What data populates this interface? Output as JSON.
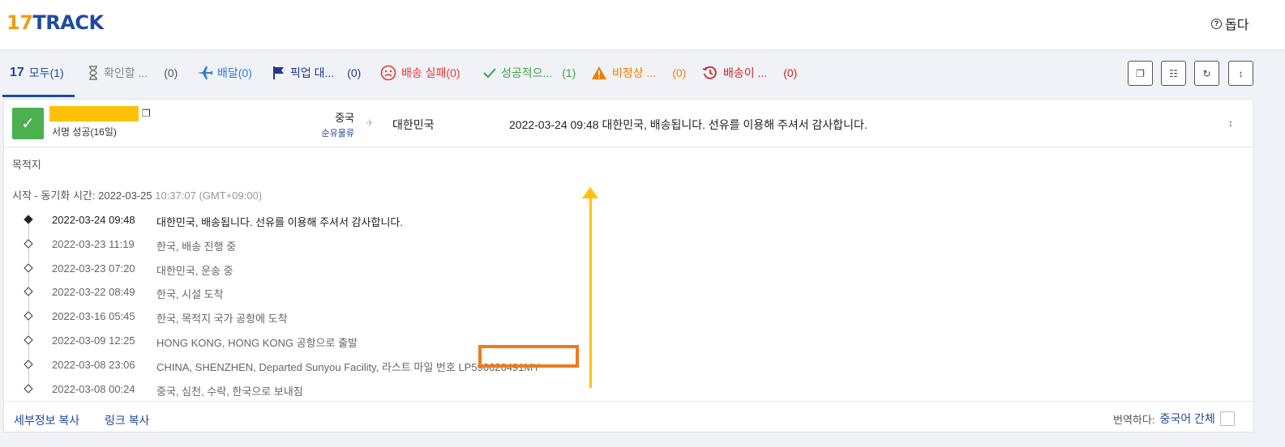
{
  "header": {
    "logo_num": "17",
    "logo_text": "TRACK",
    "help_label": "돕다"
  },
  "tabs": [
    {
      "label": "모두",
      "count": "(1)",
      "icon": "17-logo-icon",
      "color": "#1f4aa0"
    },
    {
      "label": "확인할 ...",
      "count": "(0)",
      "icon": "hourglass-icon",
      "color": "#888888"
    },
    {
      "label": "배달(0)",
      "count": "",
      "icon": "plane-icon",
      "color": "#2f7ad6"
    },
    {
      "label": "픽업 대...",
      "count": "(0)",
      "icon": "flag-icon",
      "color": "#1f3a8a"
    },
    {
      "label": "배송 실패(0)",
      "count": "",
      "icon": "sad-face-icon",
      "color": "#e53935"
    },
    {
      "label": "성공적으...",
      "count": "(1)",
      "icon": "check-icon",
      "color": "#43a047"
    },
    {
      "label": "비정상 ...",
      "count": "(0)",
      "icon": "warning-icon",
      "color": "#f57c00"
    },
    {
      "label": "배송이 ...",
      "count": "(0)",
      "icon": "history-icon",
      "color": "#c62828"
    }
  ],
  "shipment": {
    "status": "서명 성공(16일)",
    "origin_country": "중국",
    "carrier": "순유물류",
    "destination_country": "대한민국",
    "latest_time": "2022-03-24 09:48",
    "latest_desc": "대한민국, 배송됩니다. 선유를 이용해 주셔서 감사합니다."
  },
  "details": {
    "destination_label": "목적지",
    "sync_prefix": "시작 - 동기화 시간: 2022-03-25",
    "sync_time": "10:37:07 (GMT+09:00)"
  },
  "events": [
    {
      "time": "2022-03-24 09:48",
      "desc": "대한민국, 배송됩니다. 선유를 이용해 주셔서 감사합니다."
    },
    {
      "time": "2022-03-23 11:19",
      "desc": "한국, 배송 진행 중"
    },
    {
      "time": "2022-03-23 07:20",
      "desc": "대한민국, 운송 중"
    },
    {
      "time": "2022-03-22 08:49",
      "desc": "한국, 시설 도착"
    },
    {
      "time": "2022-03-16 05:45",
      "desc": "한국, 목적지 국가 공항에 도착"
    },
    {
      "time": "2022-03-09 12:25",
      "desc": "HONG KONG, HONG KONG 공항으로 출발"
    },
    {
      "time": "2022-03-08 23:06",
      "desc": "CHINA, SHENZHEN, Departed Sunyou Facility, 라스트 마일 번호 LP590626491MY"
    },
    {
      "time": "2022-03-08 00:24",
      "desc": "중국, 심천, 수락, 한국으로 보내짐"
    }
  ],
  "footer": {
    "copy_details": "세부정보 복사",
    "copy_link": "링크 복사",
    "translate_label": "번역하다:",
    "translate_lang": "중국어 간체"
  },
  "colors": {
    "brand_blue": "#1f4aa0",
    "brand_orange": "#f39c12",
    "success_green": "#4caf50",
    "annotation_orange": "#f07a1a",
    "annotation_yellow": "#ffc107"
  }
}
